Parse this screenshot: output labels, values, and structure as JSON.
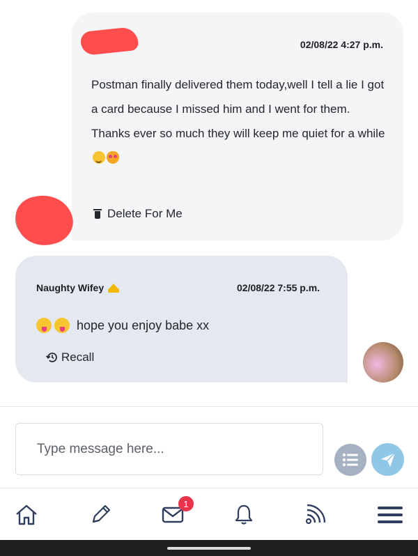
{
  "messages": [
    {
      "sender": "",
      "timestamp": "02/08/22 4:27 p.m.",
      "lines": [
        "Postman finally delivered them today,well I tell a lie I got a card because I missed him and I went for them.",
        "Thanks ever so much they will keep me quiet for a while"
      ],
      "emojis": [
        "winking-face",
        "smiling-cat-heart-eyes"
      ],
      "action": {
        "label": "Delete For Me",
        "icon": "trash-icon"
      },
      "avatar": "redacted-avatar"
    },
    {
      "sender": "Naughty Wifey",
      "sender_badge": "crown-icon",
      "timestamp": "02/08/22 7:55 p.m.",
      "text": "hope you enjoy babe xx",
      "emojis": [
        "tongue-wink-face",
        "tongue-wink-face"
      ],
      "action": {
        "label": "Recall",
        "icon": "history-icon"
      },
      "avatar": "wifey-avatar"
    }
  ],
  "composer": {
    "placeholder": "Type message here...",
    "value": ""
  },
  "nav": {
    "items": [
      "home",
      "compose",
      "messages",
      "notifications",
      "feed",
      "menu"
    ],
    "messages_badge": "1"
  },
  "colors": {
    "received_bubble": "#f4f5f7",
    "sent_bubble": "#e4e8ef",
    "send_button": "#8fc8e6",
    "list_button": "#a6b0c3",
    "badge": "#e8334a",
    "redaction": "#ff4d4d"
  }
}
